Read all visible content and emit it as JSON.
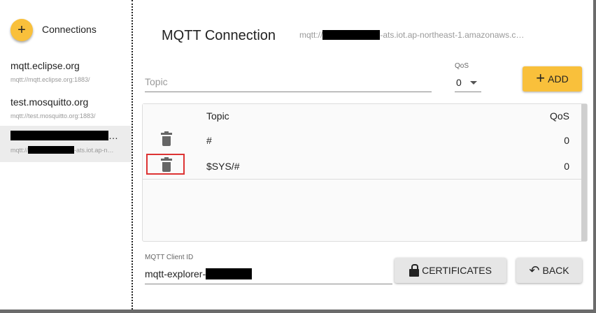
{
  "sidebar": {
    "add_button_icon": "+",
    "title": "Connections",
    "items": [
      {
        "name": "mqtt.eclipse.org",
        "url": "mqtt://mqtt.eclipse.org:1883/"
      },
      {
        "name": "test.mosquitto.org",
        "url": "mqtt://test.mosquitto.org:1883/"
      },
      {
        "name_suffix": "…",
        "url_prefix": "mqtt://",
        "url_suffix": "-ats.iot.ap-n…"
      }
    ]
  },
  "main": {
    "title": "MQTT Connection",
    "url_prefix": "mqtt://",
    "url_suffix": "-ats.iot.ap-northeast-1.amazonaws.c…"
  },
  "subscribe": {
    "topic_placeholder": "Topic",
    "qos_label": "QoS",
    "qos_value": "0",
    "add_icon": "+",
    "add_label": "ADD"
  },
  "table": {
    "headers": {
      "topic": "Topic",
      "qos": "QoS"
    },
    "rows": [
      {
        "topic": "#",
        "qos": "0"
      },
      {
        "topic": "$SYS/#",
        "qos": "0"
      }
    ]
  },
  "client": {
    "label": "MQTT Client ID",
    "value_prefix": "mqtt-explorer-"
  },
  "buttons": {
    "certificates": "CERTIFICATES",
    "back_icon": "↶",
    "back": "BACK"
  },
  "colors": {
    "accent": "#f9c03b",
    "highlight": "#dd3333"
  }
}
